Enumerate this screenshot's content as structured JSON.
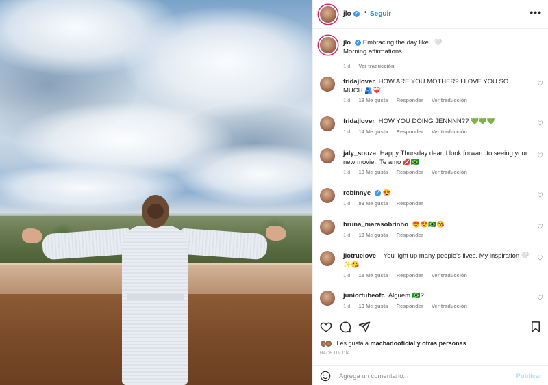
{
  "post": {
    "username": "jlo",
    "verified_mark": "✓",
    "follow_label": "Seguir",
    "more_label": "•••",
    "dot": "•"
  },
  "caption": {
    "username": "jlo",
    "text": "Embracing the day like.. 🤍",
    "text2": "Morning affirmations",
    "time": "1 d",
    "translate": "Ver traducción"
  },
  "comments": [
    {
      "username": "fridajlover",
      "text": "HOW ARE YOU MOTHER? I LOVE YOU SO MUCH 🫂❤️‍🩹",
      "time": "1 d",
      "likes": "13 Me gusta",
      "reply": "Responder",
      "translate": "Ver traducción"
    },
    {
      "username": "fridajlover",
      "text": "HOW YOU DOING JENNNN?? 💚💚💚",
      "time": "1 d",
      "likes": "14 Me gusta",
      "reply": "Responder",
      "translate": "Ver traducción"
    },
    {
      "username": "jaly_souza",
      "text": "Happy Thursday dear, I look forward to seeing your new movie.. Te amo 💋🇧🇷",
      "time": "1 d",
      "likes": "13 Me gusta",
      "reply": "Responder",
      "translate": "Ver traducción"
    },
    {
      "username": "robinnyc",
      "text": "😍",
      "time": "1 d",
      "likes": "83 Me gusta",
      "reply": "Responder",
      "translate": ""
    },
    {
      "username": "bruna_marasobrinho",
      "text": "😍😍🇧🇷😘",
      "time": "1 d",
      "likes": "19 Me gusta",
      "reply": "Responder",
      "translate": ""
    },
    {
      "username": "jlotruelove_",
      "text": "You light up many people's lives. My inspiration 🤍✨😘",
      "time": "1 d",
      "likes": "18 Me gusta",
      "reply": "Responder",
      "translate": "Ver traducción"
    },
    {
      "username": "juniortubeofc",
      "text": "Alguem 🇧🇷?",
      "time": "1 d",
      "likes": "13 Me gusta",
      "reply": "Responder",
      "translate": "Ver traducción"
    }
  ],
  "actions": {
    "likes_prefix": "Les gusta a",
    "likes_user": "machadooficial",
    "likes_suffix": "y otras personas",
    "time": "HACE UN DÍA"
  },
  "add_comment": {
    "placeholder": "Agrega un comentario...",
    "post_label": "Publicar"
  },
  "colors": {
    "link": "#0095f6",
    "verified": "#3897f0",
    "muted": "#8e8e8e",
    "post_disabled": "#b3dbff"
  },
  "icons": [
    "heart-icon",
    "comment-icon",
    "share-icon",
    "bookmark-icon",
    "emoji-icon",
    "more-icon"
  ]
}
